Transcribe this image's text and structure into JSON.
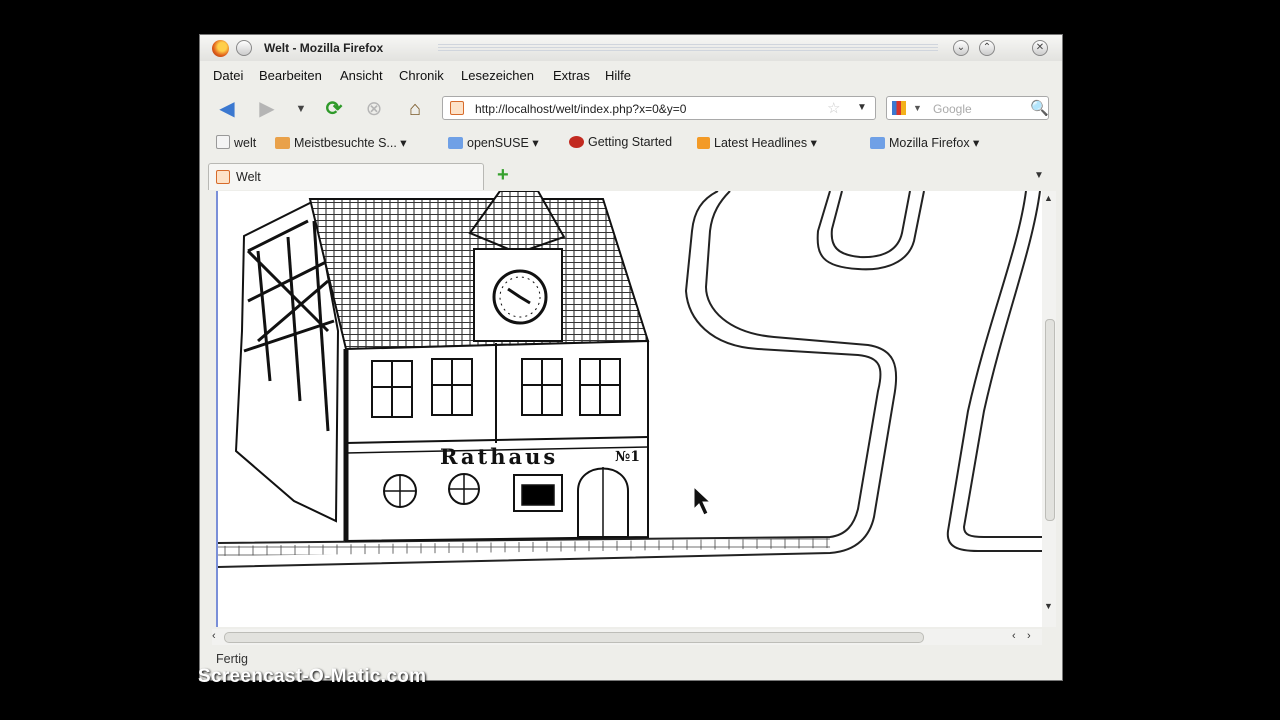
{
  "window": {
    "title": "Welt - Mozilla Firefox"
  },
  "menu": {
    "items": [
      "Datei",
      "Bearbeiten",
      "Ansicht",
      "Chronik",
      "Lesezeichen",
      "Extras",
      "Hilfe"
    ]
  },
  "navigation": {
    "url": "http://localhost/welt/index.php?x=0&y=0",
    "search_placeholder": "Google"
  },
  "bookmarks": {
    "items": [
      "welt",
      "Meistbesuchte S...",
      "openSUSE",
      "Getting Started",
      "Latest Headlines",
      "Mozilla Firefox"
    ]
  },
  "tabs": {
    "items": [
      {
        "label": "Welt"
      }
    ]
  },
  "page": {
    "sign_text": "Rathaus",
    "sign_number": "№1"
  },
  "status": {
    "text": "Fertig"
  },
  "overlay": {
    "watermark": "Screencast-O-Matic.com"
  },
  "colors": {
    "accent": "#7a8fd8",
    "reload_green": "#2f9a2a",
    "back_blue": "#3b78d0"
  }
}
